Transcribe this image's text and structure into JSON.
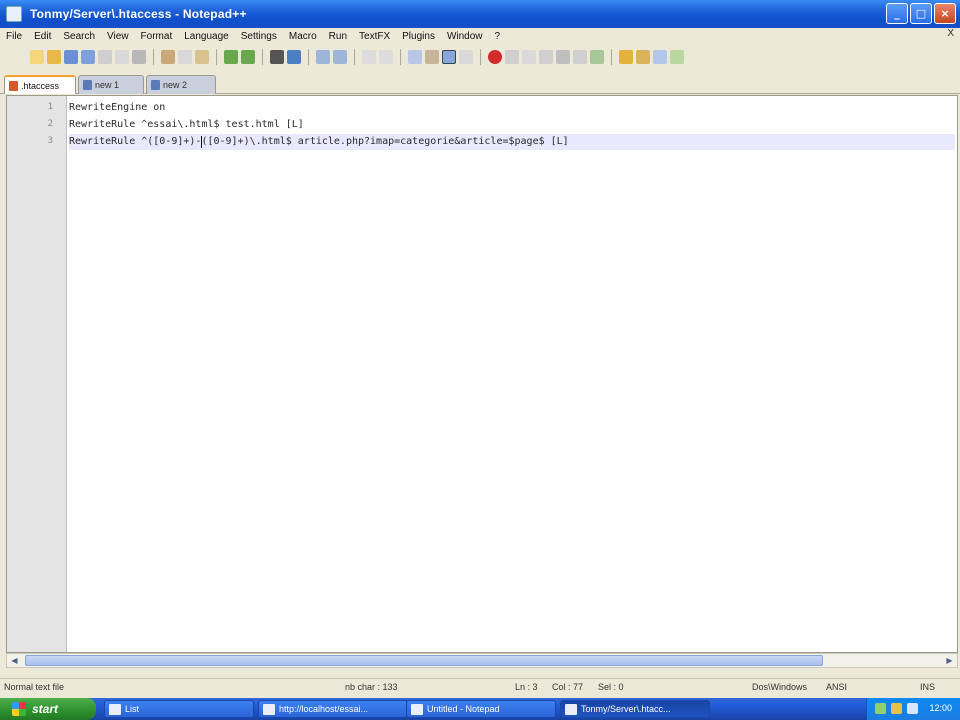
{
  "window": {
    "title": "Tonmy/Server\\.htaccess - Notepad++",
    "buttons": {
      "minimize": "_",
      "maximize": "□",
      "close": "×"
    }
  },
  "menu": [
    "File",
    "Edit",
    "Search",
    "View",
    "Format",
    "Language",
    "Settings",
    "Macro",
    "Run",
    "TextFX",
    "Plugins",
    "Window",
    "?"
  ],
  "menu_close": "X",
  "tabs": [
    {
      "label": ".htaccess",
      "active": true
    },
    {
      "label": "new 1",
      "active": false
    },
    {
      "label": "new 2",
      "active": false
    }
  ],
  "editor": {
    "lines": [
      {
        "number": "1",
        "text": "RewriteEngine on"
      },
      {
        "number": "2",
        "text": "RewriteRule ^essai\\.html$ test.html [L]"
      },
      {
        "number": "3",
        "text": "RewriteRule ^([0-9]+)-([0-9]+)\\.html$ article.php?imap=categorie&article=$page$ [L]"
      }
    ],
    "current_line": 3
  },
  "statusbar": {
    "file_type": "Normal text file",
    "length": "nb char : 133",
    "position": "Ln : 3",
    "column": "Col : 77",
    "selection": "Sel : 0",
    "eol": "Dos\\Windows",
    "encoding": "ANSI",
    "mode": "INS"
  },
  "taskbar": {
    "start_label": "start",
    "tasks": [
      {
        "label": "List"
      },
      {
        "label": "http://localhost/essai..."
      },
      {
        "label": "Untitled - Notepad"
      },
      {
        "label": "Tonmy/Server\\.htacc..."
      }
    ],
    "clock": "12:00"
  },
  "colors": {
    "titlebar": "#1c5fd6",
    "current_line": "#e8e8ff",
    "tab_accent": "#f0a030"
  }
}
